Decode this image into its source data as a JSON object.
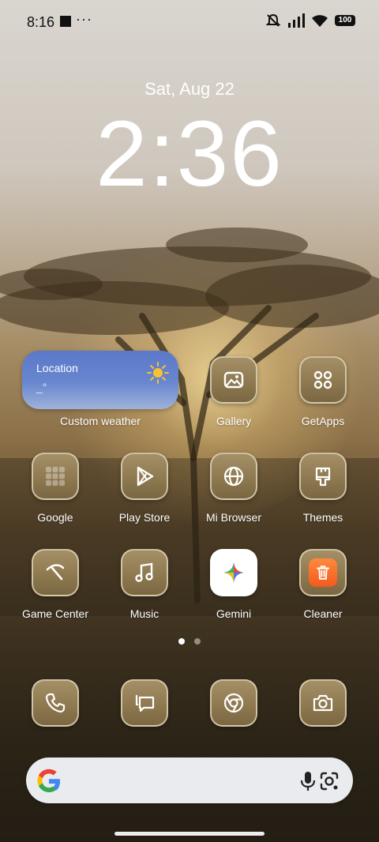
{
  "status_bar": {
    "time": "8:16",
    "more": "···",
    "battery": "100"
  },
  "lockscreen": {
    "date": "Sat, Aug 22",
    "time": "2:36"
  },
  "weather_widget": {
    "location": "Location",
    "temperature": "_°",
    "label": "Custom weather"
  },
  "apps_row1": [
    {
      "label": "Gallery"
    },
    {
      "label": "GetApps"
    }
  ],
  "apps_row2": [
    {
      "label": "Google"
    },
    {
      "label": "Play Store"
    },
    {
      "label": "Mi Browser"
    },
    {
      "label": "Themes"
    }
  ],
  "apps_row3": [
    {
      "label": "Game Center"
    },
    {
      "label": "Music"
    },
    {
      "label": "Gemini"
    },
    {
      "label": "Cleaner"
    }
  ],
  "page_indicator": {
    "pages": 2,
    "active": 1
  },
  "dock": [
    "phone-icon",
    "messages-icon",
    "chrome-icon",
    "camera-icon"
  ]
}
